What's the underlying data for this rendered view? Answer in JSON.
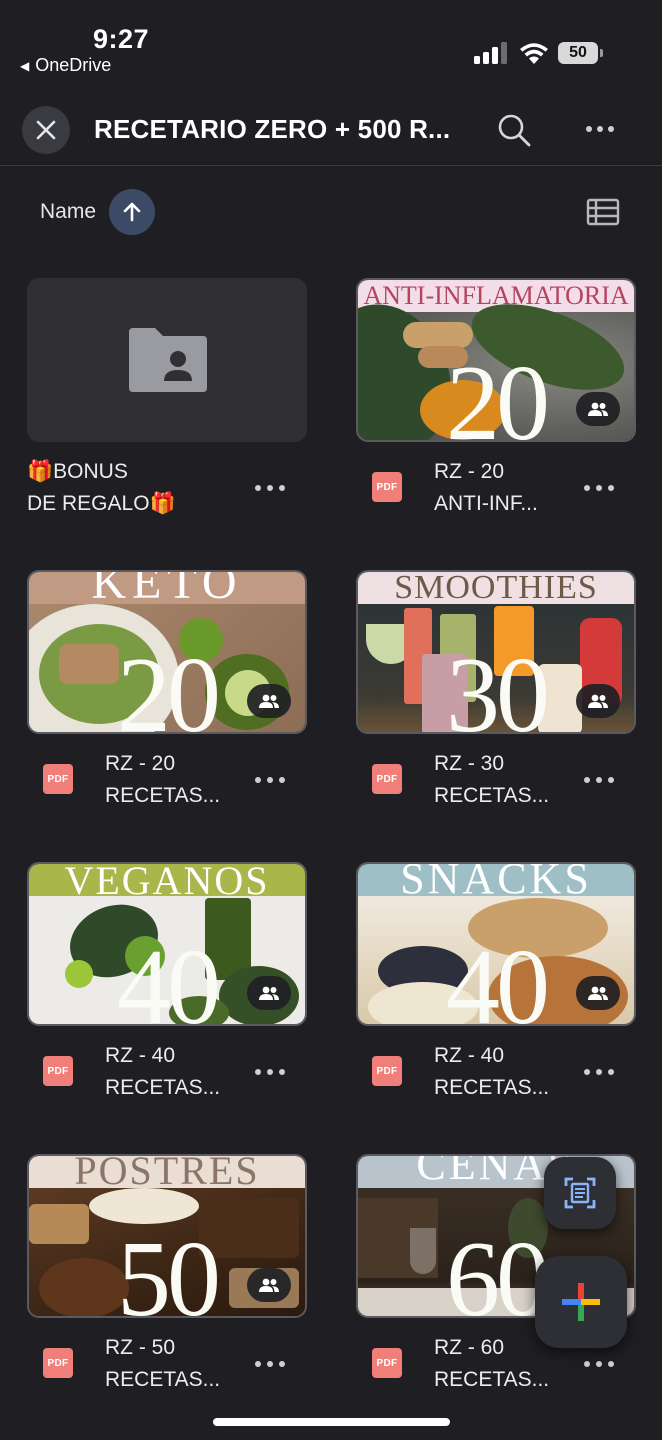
{
  "status_bar": {
    "time": "9:27",
    "back_app": "OneDrive",
    "battery": "50"
  },
  "header": {
    "title": "RECETARIO ZERO + 500 R...",
    "close_icon": "close-icon",
    "search_icon": "search-icon",
    "more_icon": "more-horizontal-icon"
  },
  "sort": {
    "label": "Name",
    "direction_icon": "arrow-up-icon",
    "view_icon": "list-view-icon"
  },
  "items": [
    {
      "kind": "folder",
      "name": "🎁BONUS\nDE REGALO🎁",
      "icon": "shared-folder-icon"
    },
    {
      "kind": "pdf",
      "name": "RZ - 20\nANTI-INF...",
      "thumb_banner": "ANTI-INFLAMATORIA",
      "thumb_number": "20",
      "banner_color": "#f2dde8",
      "banner_text_color": "#b5455f",
      "shared": true
    },
    {
      "kind": "pdf",
      "name": "RZ - 20\nRECETAS...",
      "thumb_banner": "KETO",
      "thumb_number": "20",
      "banner_color": "#c19a84",
      "banner_text_color": "#ffffff",
      "shared": true
    },
    {
      "kind": "pdf",
      "name": "RZ - 30\nRECETAS...",
      "thumb_banner": "SMOOTHIES",
      "thumb_number": "30",
      "banner_color": "#efe1e3",
      "banner_text_color": "#6e5a4a",
      "shared": true
    },
    {
      "kind": "pdf",
      "name": "RZ - 40\nRECETAS...",
      "thumb_banner": "VEGANOS",
      "thumb_number": "40",
      "banner_color": "#a8b64a",
      "banner_text_color": "#ffffff",
      "shared": true
    },
    {
      "kind": "pdf",
      "name": "RZ - 40\nRECETAS...",
      "thumb_banner": "SNACKS",
      "thumb_number": "40",
      "banner_color": "#9ebfc6",
      "banner_text_color": "#ffffff",
      "shared": true
    },
    {
      "kind": "pdf",
      "name": "RZ - 50\nRECETAS...",
      "thumb_banner": "POSTRES",
      "thumb_number": "50",
      "banner_color": "#e9ddd4",
      "banner_text_color": "#8a7668",
      "shared": true
    },
    {
      "kind": "pdf",
      "name": "RZ - 60\nRECETAS...",
      "thumb_banner": "CENAS",
      "thumb_number": "60",
      "banner_color": "#b9c3cb",
      "banner_text_color": "#ffffff",
      "shared": false
    }
  ],
  "file_badge": "PDF",
  "fabs": {
    "scan_icon": "document-scan-icon",
    "new_icon": "plus-icon"
  }
}
